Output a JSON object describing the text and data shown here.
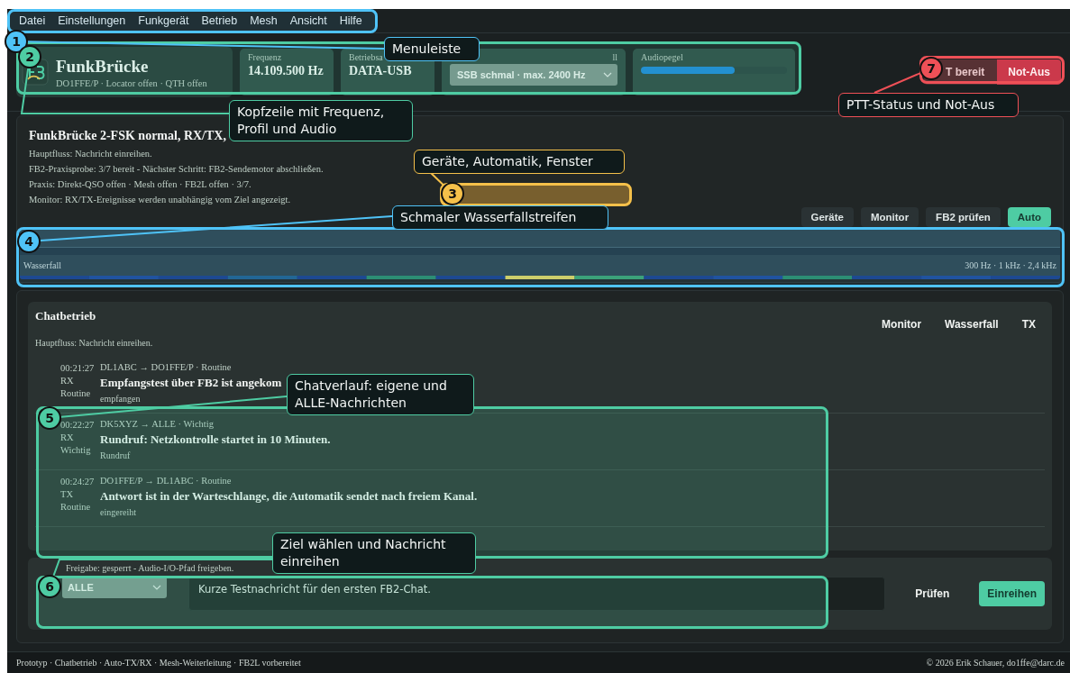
{
  "menu": [
    {
      "label": "Datei"
    },
    {
      "label": "Einstellungen"
    },
    {
      "label": "Funkgerät"
    },
    {
      "label": "Betrieb"
    },
    {
      "label": "Mesh"
    },
    {
      "label": "Ansicht"
    },
    {
      "label": "Hilfe"
    }
  ],
  "header": {
    "app_title": "FunkBrücke",
    "subtitle": "DO1FFE/P · Locator offen · QTH offen",
    "fields": [
      {
        "kind": "text",
        "label": "Frequenz",
        "value": "14.109.500 Hz"
      },
      {
        "kind": "text",
        "label": "Betriebsa",
        "value": "DATA-USB"
      },
      {
        "kind": "select",
        "label": "ll",
        "value": "SSB schmal · max. 2400 Hz"
      },
      {
        "kind": "meter",
        "label": "Audiopegel",
        "level": 0.64
      }
    ]
  },
  "ptt": {
    "status": "T bereit",
    "emergency": "Not-Aus"
  },
  "status_panel": {
    "title": "FunkBrücke 2-FSK normal, RX/TX,",
    "lines": [
      "Hauptfluss: Nachricht einreihen.",
      "FB2-Praxisprobe: 3/7 bereit - Nächster Schritt: FB2-Sendemotor abschließen.",
      "Praxis: Direkt-QSO offen · Mesh offen · FB2L offen · 3/7.",
      "Monitor: RX/TX-Ereignisse werden unabhängig vom Ziel angezeigt."
    ],
    "buttons": [
      {
        "label": "Geräte",
        "selected": false
      },
      {
        "label": "Monitor",
        "selected": false
      },
      {
        "label": "FB2 prüfen",
        "selected": false
      },
      {
        "label": "Auto",
        "selected": true
      }
    ]
  },
  "waterfall": {
    "label": "Wasserfall",
    "scale": "300 Hz · 1 kHz · 2,4 kHz"
  },
  "chat": {
    "title": "Chatbetrieb",
    "hint": "Hauptfluss: Nachricht einreihen.",
    "tabs": [
      {
        "label": "Monitor"
      },
      {
        "label": "Wasserfall"
      },
      {
        "label": "TX"
      }
    ],
    "messages": [
      {
        "time": "00:21:27",
        "direction": "RX",
        "priority": "Routine",
        "route": "DL1ABC → DO1FFE/P · Routine",
        "text": "Empfangstest über FB2 ist angekom",
        "status": "empfangen"
      },
      {
        "time": "00:22:27",
        "direction": "RX",
        "priority": "Wichtig",
        "route": "DK5XYZ → ALLE · Wichtig",
        "text": "Rundruf: Netzkontrolle startet in 10 Minuten.",
        "status": "Rundruf"
      },
      {
        "time": "00:24:27",
        "direction": "TX",
        "priority": "Routine",
        "route": "DO1FFE/P → DL1ABC · Routine",
        "text": "Antwort ist in der Warteschlange, die Automatik sendet nach freiem Kanal.",
        "status": "eingereiht"
      }
    ]
  },
  "composer": {
    "notice": "Freigabe: gesperrt - Audio-I/O-Pfad freigeben.",
    "target": "ALLE",
    "message": "Kurze Testnachricht für den ersten FB2-Chat.",
    "buttons": [
      {
        "label": "Prüfen",
        "kind": "plain"
      },
      {
        "label": "Einreihen",
        "kind": "primary"
      }
    ]
  },
  "footer": {
    "left": "Prototyp · Chatbetrieb · Auto-TX/RX · Mesh-Weiterleitung · FB2L vorbereitet",
    "right": "© 2026 Erik Schauer, do1ffe@darc.de"
  },
  "annotations": [
    {
      "number": "1",
      "label": "Menuleiste",
      "color": "#4fc3f7"
    },
    {
      "number": "2",
      "label": "Kopfzeile mit Frequenz, Profil und Audio",
      "color": "#4ecca3"
    },
    {
      "number": "3",
      "label": "Geräte, Automatik, Fenster",
      "color": "#f5c04a"
    },
    {
      "number": "4",
      "label": "Schmaler Wasserfallstreifen",
      "color": "#4fc3f7"
    },
    {
      "number": "5",
      "label": "Chatverlauf: eigene und ALLE-Nachrichten",
      "color": "#4ecca3"
    },
    {
      "number": "6",
      "label": "Ziel wählen und Nachricht einreihen",
      "color": "#4ecca3"
    },
    {
      "number": "7",
      "label": "PTT-Status und Not-Aus",
      "color": "#ef5057"
    }
  ]
}
